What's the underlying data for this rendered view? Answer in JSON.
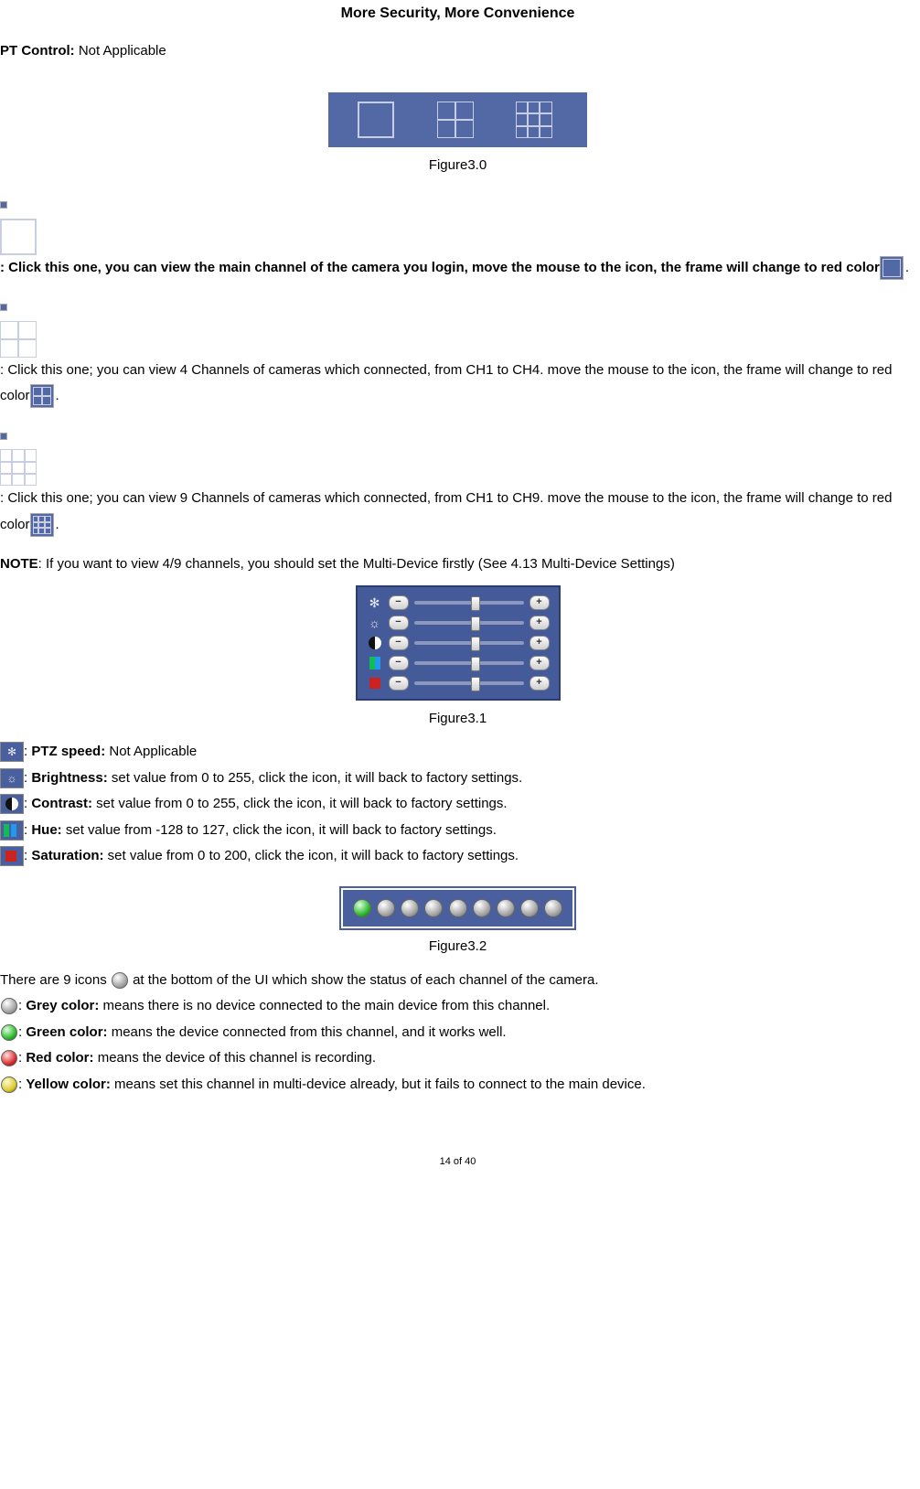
{
  "header": {
    "title": "More Security, More Convenience"
  },
  "pt_control": {
    "label": "PT Control:",
    "value": "Not Applicable"
  },
  "figures": {
    "f30": "Figure3.0",
    "f31": "Figure3.1",
    "f32": "Figure3.2"
  },
  "desc": {
    "single_a": ": Click this one, you can view the main channel of the camera you login, move the mouse to the icon, the frame will change to red color",
    "single_b": ".",
    "four_a": ": Click this one; you can view 4 Channels of cameras which connected, from CH1 to CH4. move the mouse to the icon, the frame will change to red color",
    "four_b": ".",
    "nine_a": ": Click this one; you can view 9 Channels of cameras which connected, from CH1 to CH9. move the mouse to the icon, the frame will change to red color",
    "nine_b": "."
  },
  "note": {
    "label": "NOTE",
    "text": ": If you want to view 4/9 channels, you should set the Multi-Device firstly (See 4.13 Multi-Device Settings)"
  },
  "controls": {
    "ptz": {
      "label": "PTZ speed:",
      "text": " Not Applicable"
    },
    "brightness": {
      "label": "Brightness:",
      "text": " set value from 0 to 255, click the icon, it will back to factory settings."
    },
    "contrast": {
      "label": "Contrast:",
      "text": " set value from 0 to 255, click the icon, it will back to factory settings."
    },
    "hue": {
      "label": "Hue:",
      "text": " set value from -128 to 127, click the icon, it will back to factory settings."
    },
    "saturation": {
      "label": "Saturation:",
      "text": " set value from 0 to 200, click the icon, it will back to factory settings."
    }
  },
  "status": {
    "intro_a": "There are 9 icons ",
    "intro_b": " at the bottom of the UI which show the status of each channel of the camera.",
    "grey": {
      "label": "Grey color:",
      "text": " means there is no device connected to the main device from this channel."
    },
    "green": {
      "label": "Green color:",
      "text": " means the device connected from this channel, and it works well."
    },
    "red": {
      "label": "Red color:",
      "text": " means the device of this channel is recording."
    },
    "yellow": {
      "label": "Yellow color:",
      "text": " means set this channel in multi-device already, but it fails to connect to the main device."
    }
  },
  "footer": "14 of 40",
  "chart_data": {
    "type": "table",
    "title": "Figure3.1 camera image adjustment controls (slider ranges)",
    "rows": [
      {
        "control": "PTZ speed",
        "min": null,
        "max": null,
        "note": "Not Applicable"
      },
      {
        "control": "Brightness",
        "min": 0,
        "max": 255
      },
      {
        "control": "Contrast",
        "min": 0,
        "max": 255
      },
      {
        "control": "Hue",
        "min": -128,
        "max": 127
      },
      {
        "control": "Saturation",
        "min": 0,
        "max": 200
      }
    ]
  }
}
